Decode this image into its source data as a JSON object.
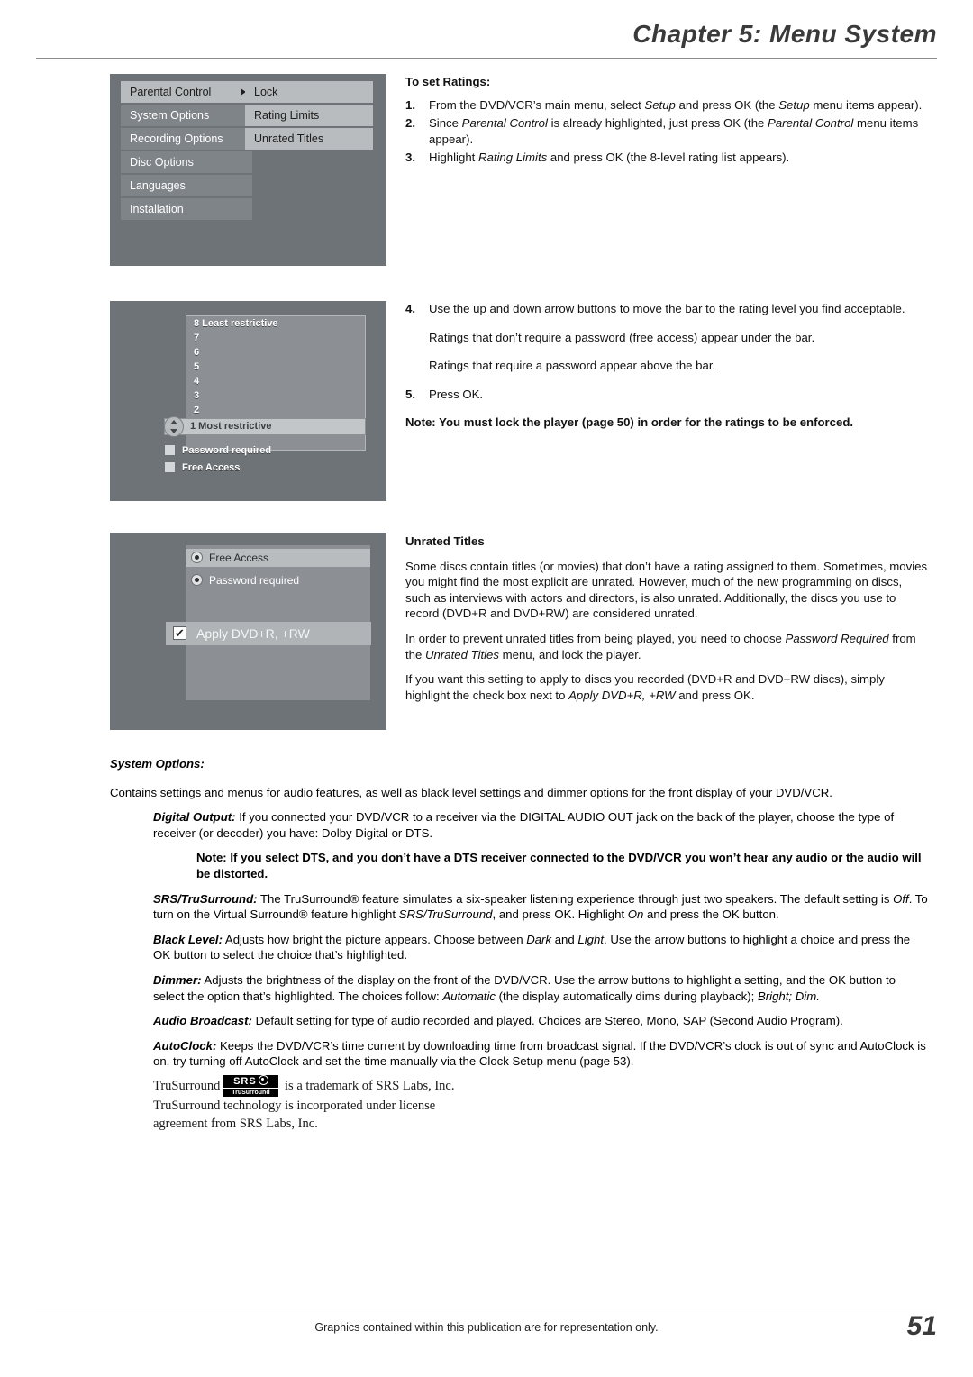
{
  "header": {
    "chapter_title": "Chapter 5: Menu System"
  },
  "screens": {
    "screen1": {
      "left_menu": [
        "Parental Control",
        "System Options",
        "Recording Options",
        "Disc Options",
        "Languages",
        "Installation"
      ],
      "right_menu": [
        "Lock",
        "Rating Limits",
        "Unrated Titles"
      ]
    },
    "screen2": {
      "ratings": [
        "8 Least restrictive",
        "7",
        "6",
        "5",
        "4",
        "3",
        "2"
      ],
      "selected_bar": "1 Most restrictive",
      "checkboxes": [
        "Password required",
        "Free Access"
      ]
    },
    "screen3": {
      "options": [
        "Free Access",
        "Password required"
      ],
      "apply_label": "Apply DVD+R, +RW",
      "apply_check": "✔"
    }
  },
  "main": {
    "to_set_ratings_heading": "To set Ratings:",
    "steps": [
      {
        "n": "1.",
        "parts": [
          {
            "t": "From the DVD/VCR’s main menu, select ",
            "s": "n"
          },
          {
            "t": "Setup",
            "s": "i"
          },
          {
            "t": " and press OK (the ",
            "s": "n"
          },
          {
            "t": "Setup",
            "s": "i"
          },
          {
            "t": " menu items appear).",
            "s": "n"
          }
        ]
      },
      {
        "n": "2.",
        "parts": [
          {
            "t": "Since ",
            "s": "n"
          },
          {
            "t": "Parental Control",
            "s": "i"
          },
          {
            "t": " is already highlighted, just press OK (the ",
            "s": "n"
          },
          {
            "t": "Parental Control",
            "s": "i"
          },
          {
            "t": " menu items appear).",
            "s": "n"
          }
        ]
      },
      {
        "n": "3.",
        "parts": [
          {
            "t": "Highlight ",
            "s": "n"
          },
          {
            "t": "Rating Limits",
            "s": "i"
          },
          {
            "t": " and press OK (the 8-level rating list appears).",
            "s": "n"
          }
        ]
      }
    ],
    "step4": {
      "n": "4.",
      "text": "Use the up and down arrow buttons to move the bar to the rating level you find acceptable."
    },
    "step4_notes": [
      "Ratings that don’t require a password (free access) appear under the bar.",
      "Ratings that require a password appear above the bar."
    ],
    "step5": {
      "n": "5.",
      "text": "Press OK."
    },
    "lock_note": "Note: You must lock the player (page 50) in order for the ratings to be enforced.",
    "unrated_heading": "Unrated Titles",
    "unrated_p1": "Some discs contain titles (or movies) that don’t have a rating assigned to them. Sometimes, movies you might find the most explicit are unrated. However, much of the new programming on discs, such as interviews with actors and directors, is also unrated. Additionally, the discs you use to record (DVD+R and DVD+RW) are considered unrated.",
    "unrated_p2_parts": [
      {
        "t": "In order to prevent unrated titles from being played, you need to choose ",
        "s": "n"
      },
      {
        "t": "Password Required",
        "s": "i"
      },
      {
        "t": " from the ",
        "s": "n"
      },
      {
        "t": "Unrated Titles",
        "s": "i"
      },
      {
        "t": " menu, and lock the player.",
        "s": "n"
      }
    ],
    "unrated_p3_parts": [
      {
        "t": "If you want this setting to apply to discs you recorded (DVD+R and DVD+RW discs), simply highlight the check box next to ",
        "s": "n"
      },
      {
        "t": "Apply DVD+R, +RW",
        "s": "i"
      },
      {
        "t": " and press OK.",
        "s": "n"
      }
    ]
  },
  "system_options": {
    "heading": "System Options:",
    "intro": "Contains settings and menus for audio features, as well as black level settings and dimmer options for the front display of your DVD/VCR.",
    "items": [
      {
        "parts": [
          {
            "t": "Digital Output:",
            "s": "bi"
          },
          {
            "t": " If you connected your DVD/VCR to a receiver via the DIGITAL AUDIO OUT jack on the back of the player, choose the type of receiver (or decoder) you have: Dolby Digital or DTS.",
            "s": "n"
          }
        ]
      },
      {
        "parts": [
          {
            "t": "Note: If you select DTS, and you don’t have a DTS receiver connected to the DVD/VCR you won’t hear any audio or the audio will be distorted.",
            "s": "b"
          }
        ],
        "indent": true
      },
      {
        "parts": [
          {
            "t": "SRS/TruSurround:",
            "s": "bi"
          },
          {
            "t": " The TruSurround® feature simulates a six-speaker listening experience through just two speakers. The default setting is ",
            "s": "n"
          },
          {
            "t": "Off",
            "s": "i"
          },
          {
            "t": ". To turn on the Virtual Surround® feature highlight ",
            "s": "n"
          },
          {
            "t": "SRS/TruSurround",
            "s": "i"
          },
          {
            "t": ", and press OK. Highlight ",
            "s": "n"
          },
          {
            "t": "On",
            "s": "i"
          },
          {
            "t": " and press the OK button.",
            "s": "n"
          }
        ]
      },
      {
        "parts": [
          {
            "t": "Black Level:",
            "s": "bi"
          },
          {
            "t": " Adjusts how bright the picture appears. Choose between ",
            "s": "n"
          },
          {
            "t": "Dark",
            "s": "i"
          },
          {
            "t": " and ",
            "s": "n"
          },
          {
            "t": "Light",
            "s": "i"
          },
          {
            "t": ". Use the arrow buttons to highlight a choice and press the OK button to select the choice that’s highlighted.",
            "s": "n"
          }
        ]
      },
      {
        "parts": [
          {
            "t": "Dimmer:",
            "s": "bi"
          },
          {
            "t": " Adjusts the brightness of the display on the front of the DVD/VCR. Use the arrow buttons to highlight a setting, and the OK button to select the option that’s highlighted. The choices follow: ",
            "s": "n"
          },
          {
            "t": "Automatic",
            "s": "i"
          },
          {
            "t": " (the display automatically dims during playback); ",
            "s": "n"
          },
          {
            "t": "Bright; Dim.",
            "s": "i"
          }
        ]
      },
      {
        "parts": [
          {
            "t": "Audio Broadcast:",
            "s": "bi"
          },
          {
            "t": " Default setting for type of audio recorded and played. Choices are Stereo, Mono, SAP (Second Audio Program).",
            "s": "n"
          }
        ]
      },
      {
        "parts": [
          {
            "t": "AutoClock:",
            "s": "bi"
          },
          {
            "t": " Keeps the DVD/VCR’s time current by downloading time from broadcast signal. If the DVD/VCR’s clock is out of sync and AutoClock is on, try turning off AutoClock and set the time manually via the Clock Setup menu (page 53).",
            "s": "n"
          }
        ]
      }
    ]
  },
  "trademark": {
    "line1_pre": "TruSurround",
    "line1_post": " is a trademark of SRS Labs, Inc.",
    "logo_top": "SRS",
    "logo_bottom": "TruSurround",
    "line2": "TruSurround technology is incorporated under license",
    "line3": "agreement from SRS Labs, Inc."
  },
  "footer": {
    "note": "Graphics contained within this publication are for representation only.",
    "page_number": "51"
  }
}
